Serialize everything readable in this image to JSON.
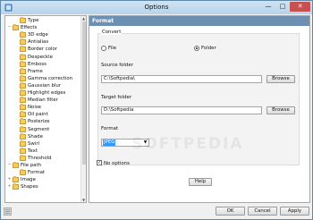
{
  "window": {
    "title": "Options",
    "minimize_glyph": "—",
    "maximize_glyph": "□",
    "close_glyph": "✕"
  },
  "tree": [
    {
      "label": "Type",
      "indent": 2,
      "expander": ""
    },
    {
      "label": "Effects",
      "indent": 1,
      "expander": "−"
    },
    {
      "label": "3D edge",
      "indent": 2,
      "expander": ""
    },
    {
      "label": "Antialias",
      "indent": 2,
      "expander": ""
    },
    {
      "label": "Border color",
      "indent": 2,
      "expander": ""
    },
    {
      "label": "Despeckle",
      "indent": 2,
      "expander": ""
    },
    {
      "label": "Emboss",
      "indent": 2,
      "expander": ""
    },
    {
      "label": "Frame",
      "indent": 2,
      "expander": ""
    },
    {
      "label": "Gamma correction",
      "indent": 2,
      "expander": ""
    },
    {
      "label": "Gaussian blur",
      "indent": 2,
      "expander": ""
    },
    {
      "label": "Highlight edges",
      "indent": 2,
      "expander": ""
    },
    {
      "label": "Median filter",
      "indent": 2,
      "expander": ""
    },
    {
      "label": "Noise",
      "indent": 2,
      "expander": ""
    },
    {
      "label": "Oil paint",
      "indent": 2,
      "expander": ""
    },
    {
      "label": "Posterize",
      "indent": 2,
      "expander": ""
    },
    {
      "label": "Segment",
      "indent": 2,
      "expander": ""
    },
    {
      "label": "Shade",
      "indent": 2,
      "expander": ""
    },
    {
      "label": "Swirl",
      "indent": 2,
      "expander": ""
    },
    {
      "label": "Text",
      "indent": 2,
      "expander": ""
    },
    {
      "label": "Threshold",
      "indent": 2,
      "expander": ""
    },
    {
      "label": "File path",
      "indent": 1,
      "expander": "−"
    },
    {
      "label": "Format",
      "indent": 2,
      "expander": ""
    },
    {
      "label": "Image",
      "indent": 1,
      "expander": "+"
    },
    {
      "label": "Shapes",
      "indent": 1,
      "expander": "+"
    }
  ],
  "panel": {
    "header": "Format",
    "convert_label": "Convert",
    "file_option": "File",
    "folder_option": "Folder",
    "selected_option": "Folder",
    "source_label": "Source folder",
    "source_value": "C:\\Softpedia\\",
    "browse_label": "Browse",
    "target_label": "Target folder",
    "target_value": "D:\\Softpedia",
    "format_label": "Format",
    "format_value": "JPEG",
    "no_options_label": "No options",
    "no_options_checked": true,
    "check_glyph": "✓",
    "help_label": "Help"
  },
  "footer": {
    "ok": "OK",
    "cancel": "Cancel",
    "apply": "Apply"
  },
  "watermark": "SOFTPEDIA",
  "icons": {
    "app": "options-app-icon",
    "folder": "folder-icon",
    "grip": "app-grip-icon"
  },
  "colors": {
    "header": "#6d8fb1",
    "close": "#c75050",
    "selection": "#3399ff",
    "folder": "#f3cd63"
  }
}
